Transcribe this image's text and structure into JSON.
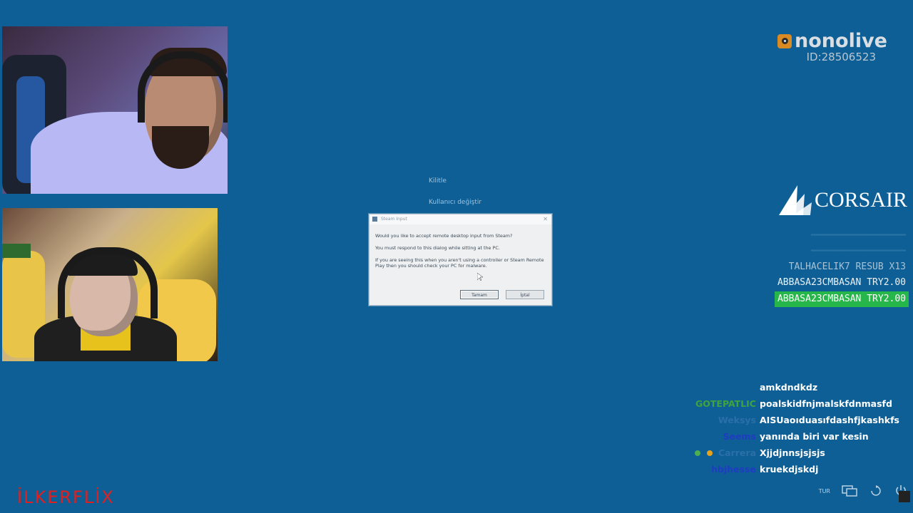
{
  "watermark": "İLKERFLİX",
  "brand": {
    "name": "nonolive",
    "id": "ID:28506523"
  },
  "sponsor": {
    "name": "CORSAIR"
  },
  "alerts": [
    {
      "text": "TALHACELIK7 RESUB X13",
      "style": "dim"
    },
    {
      "text": "ABBASA23CMBASAN TRY2.00",
      "style": "normal"
    },
    {
      "text": "ABBASA23CMBASAN TRY2.00",
      "style": "highlight"
    }
  ],
  "desktop": {
    "label_1": "Kilitle",
    "label_2": "Kullanıcı değiştir"
  },
  "dialog": {
    "title": "Steam Input",
    "line_1": "Would you like to accept remote desktop input from Steam?",
    "line_2": "You must respond to this dialog while sitting at the PC.",
    "line_3": "If you are seeing this when you aren't using a controller or Steam Remote Play then you should check your PC for malware.",
    "btn_primary": "Tamam",
    "btn_secondary": "İptal"
  },
  "chat": [
    {
      "user": "",
      "msg": "amkdndkdz",
      "color": "#ffffff"
    },
    {
      "user": "GOTEPATLIC",
      "msg": "poalskidfnjmalskfdnmasfd",
      "color": "#3fa33f"
    },
    {
      "user": "Weksys",
      "msg": "AISUaoıduasıfdashfjkashkfs",
      "color": "#2b6fa8"
    },
    {
      "user": "Seems",
      "msg": "yanında biri var kesin",
      "color": "#1f3cc2"
    },
    {
      "user": "Carrera",
      "msg": "Xjjdjnnsjsjsjs",
      "color": "#2b6fa8"
    },
    {
      "user": "hbjhesse",
      "msg": "kruekdjskdj",
      "color": "#1f3cc2"
    }
  ],
  "taskbar": {
    "lang": "TUR"
  },
  "colors": {
    "background": "#0e5f95",
    "highlight": "#26b64a",
    "watermark": "#e21f1f"
  }
}
